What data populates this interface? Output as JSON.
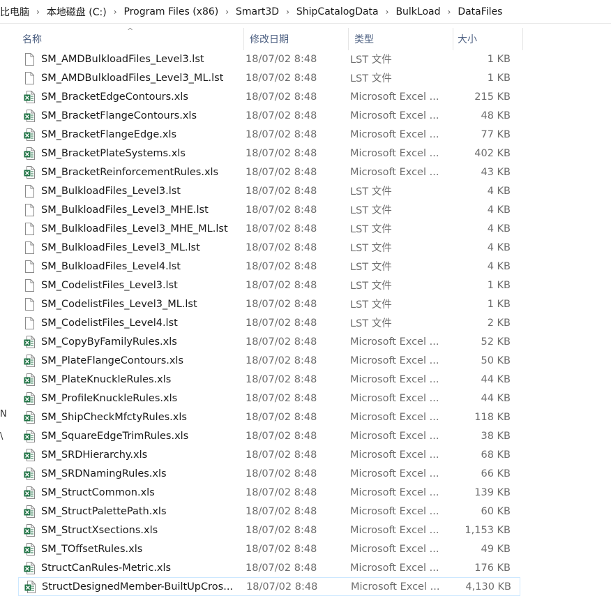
{
  "breadcrumb": [
    "比电脑",
    "本地磁盘 (C:)",
    "Program Files (x86)",
    "Smart3D",
    "ShipCatalogData",
    "BulkLoad",
    "DataFiles"
  ],
  "columns": {
    "name": "名称",
    "date": "修改日期",
    "type": "类型",
    "size": "大小"
  },
  "left_pane_marks": [
    "N",
    "\\"
  ],
  "colors": {
    "header_text": "#4d6082",
    "excel_green": "#1f7244",
    "selected_border": "#cde8ff"
  },
  "files": [
    {
      "name": "SM_AMDBulkloadFiles_Level3.lst",
      "date": "18/07/02 8:48",
      "type": "LST 文件",
      "size": "1 KB",
      "icon": "text-file-icon"
    },
    {
      "name": "SM_AMDBulkloadFiles_Level3_ML.lst",
      "date": "18/07/02 8:48",
      "type": "LST 文件",
      "size": "1 KB",
      "icon": "text-file-icon"
    },
    {
      "name": "SM_BracketEdgeContours.xls",
      "date": "18/07/02 8:48",
      "type": "Microsoft Excel ...",
      "size": "215 KB",
      "icon": "excel-file-icon"
    },
    {
      "name": "SM_BracketFlangeContours.xls",
      "date": "18/07/02 8:48",
      "type": "Microsoft Excel ...",
      "size": "48 KB",
      "icon": "excel-file-icon"
    },
    {
      "name": "SM_BracketFlangeEdge.xls",
      "date": "18/07/02 8:48",
      "type": "Microsoft Excel ...",
      "size": "77 KB",
      "icon": "excel-file-icon"
    },
    {
      "name": "SM_BracketPlateSystems.xls",
      "date": "18/07/02 8:48",
      "type": "Microsoft Excel ...",
      "size": "402 KB",
      "icon": "excel-file-icon"
    },
    {
      "name": "SM_BracketReinforcementRules.xls",
      "date": "18/07/02 8:48",
      "type": "Microsoft Excel ...",
      "size": "43 KB",
      "icon": "excel-file-icon"
    },
    {
      "name": "SM_BulkloadFiles_Level3.lst",
      "date": "18/07/02 8:48",
      "type": "LST 文件",
      "size": "4 KB",
      "icon": "text-file-icon"
    },
    {
      "name": "SM_BulkloadFiles_Level3_MHE.lst",
      "date": "18/07/02 8:48",
      "type": "LST 文件",
      "size": "4 KB",
      "icon": "text-file-icon"
    },
    {
      "name": "SM_BulkloadFiles_Level3_MHE_ML.lst",
      "date": "18/07/02 8:48",
      "type": "LST 文件",
      "size": "4 KB",
      "icon": "text-file-icon"
    },
    {
      "name": "SM_BulkloadFiles_Level3_ML.lst",
      "date": "18/07/02 8:48",
      "type": "LST 文件",
      "size": "4 KB",
      "icon": "text-file-icon"
    },
    {
      "name": "SM_BulkloadFiles_Level4.lst",
      "date": "18/07/02 8:48",
      "type": "LST 文件",
      "size": "4 KB",
      "icon": "text-file-icon"
    },
    {
      "name": "SM_CodelistFiles_Level3.lst",
      "date": "18/07/02 8:48",
      "type": "LST 文件",
      "size": "1 KB",
      "icon": "text-file-icon"
    },
    {
      "name": "SM_CodelistFiles_Level3_ML.lst",
      "date": "18/07/02 8:48",
      "type": "LST 文件",
      "size": "1 KB",
      "icon": "text-file-icon"
    },
    {
      "name": "SM_CodelistFiles_Level4.lst",
      "date": "18/07/02 8:48",
      "type": "LST 文件",
      "size": "2 KB",
      "icon": "text-file-icon"
    },
    {
      "name": "SM_CopyByFamilyRules.xls",
      "date": "18/07/02 8:48",
      "type": "Microsoft Excel ...",
      "size": "52 KB",
      "icon": "excel-file-icon"
    },
    {
      "name": "SM_PlateFlangeContours.xls",
      "date": "18/07/02 8:48",
      "type": "Microsoft Excel ...",
      "size": "50 KB",
      "icon": "excel-file-icon"
    },
    {
      "name": "SM_PlateKnuckleRules.xls",
      "date": "18/07/02 8:48",
      "type": "Microsoft Excel ...",
      "size": "44 KB",
      "icon": "excel-file-icon"
    },
    {
      "name": "SM_ProfileKnuckleRules.xls",
      "date": "18/07/02 8:48",
      "type": "Microsoft Excel ...",
      "size": "44 KB",
      "icon": "excel-file-icon"
    },
    {
      "name": "SM_ShipCheckMfctyRules.xls",
      "date": "18/07/02 8:48",
      "type": "Microsoft Excel ...",
      "size": "118 KB",
      "icon": "excel-file-icon"
    },
    {
      "name": "SM_SquareEdgeTrimRules.xls",
      "date": "18/07/02 8:48",
      "type": "Microsoft Excel ...",
      "size": "38 KB",
      "icon": "excel-file-icon"
    },
    {
      "name": "SM_SRDHierarchy.xls",
      "date": "18/07/02 8:48",
      "type": "Microsoft Excel ...",
      "size": "68 KB",
      "icon": "excel-file-icon"
    },
    {
      "name": "SM_SRDNamingRules.xls",
      "date": "18/07/02 8:48",
      "type": "Microsoft Excel ...",
      "size": "66 KB",
      "icon": "excel-file-icon"
    },
    {
      "name": "SM_StructCommon.xls",
      "date": "18/07/02 8:48",
      "type": "Microsoft Excel ...",
      "size": "139 KB",
      "icon": "excel-file-icon"
    },
    {
      "name": "SM_StructPalettePath.xls",
      "date": "18/07/02 8:48",
      "type": "Microsoft Excel ...",
      "size": "60 KB",
      "icon": "excel-file-icon"
    },
    {
      "name": "SM_StructXsections.xls",
      "date": "18/07/02 8:48",
      "type": "Microsoft Excel ...",
      "size": "1,153 KB",
      "icon": "excel-file-icon"
    },
    {
      "name": "SM_TOffsetRules.xls",
      "date": "18/07/02 8:48",
      "type": "Microsoft Excel ...",
      "size": "49 KB",
      "icon": "excel-file-icon"
    },
    {
      "name": "StructCanRules-Metric.xls",
      "date": "18/07/02 8:48",
      "type": "Microsoft Excel ...",
      "size": "176 KB",
      "icon": "excel-file-icon"
    },
    {
      "name": "StructDesignedMember-BuiltUpCros...",
      "date": "18/07/02 8:48",
      "type": "Microsoft Excel ...",
      "size": "4,130 KB",
      "icon": "excel-file-icon",
      "selected": true
    }
  ]
}
